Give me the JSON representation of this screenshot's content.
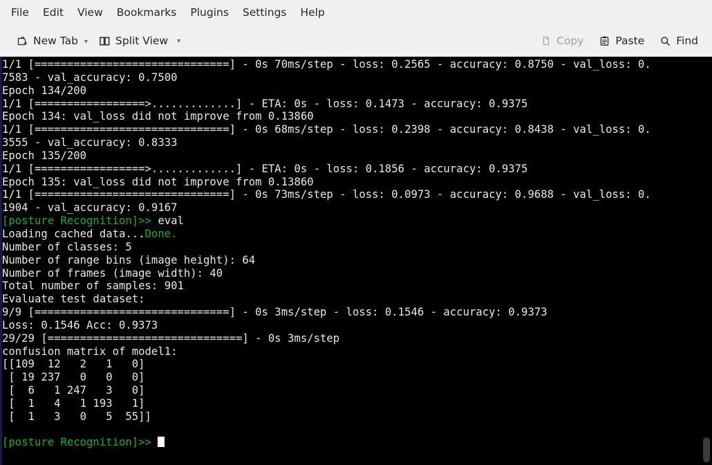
{
  "menubar": {
    "items": [
      {
        "label": "File",
        "name": "menu-file"
      },
      {
        "label": "Edit",
        "name": "menu-edit"
      },
      {
        "label": "View",
        "name": "menu-view"
      },
      {
        "label": "Bookmarks",
        "name": "menu-bookmarks"
      },
      {
        "label": "Plugins",
        "name": "menu-plugins"
      },
      {
        "label": "Settings",
        "name": "menu-settings"
      },
      {
        "label": "Help",
        "name": "menu-help"
      }
    ]
  },
  "toolbar": {
    "new_tab_label": "New Tab",
    "split_view_label": "Split View",
    "copy_label": "Copy",
    "paste_label": "Paste",
    "find_label": "Find",
    "copy_disabled": true
  },
  "terminal": {
    "prompt": "[posture Recognition]>>",
    "command": " eval",
    "lines": {
      "l01": "1/1 [==============================] - 0s 70ms/step - loss: 0.2565 - accuracy: 0.8750 - val_loss: 0.",
      "l02": "7583 - val_accuracy: 0.7500",
      "l03": "Epoch 134/200",
      "l04": "1/1 [=================>.............] - ETA: 0s - loss: 0.1473 - accuracy: 0.9375",
      "l05": "Epoch 134: val_loss did not improve from 0.13860",
      "l06": "1/1 [==============================] - 0s 68ms/step - loss: 0.2398 - accuracy: 0.8438 - val_loss: 0.",
      "l07": "3555 - val_accuracy: 0.8333",
      "l08": "Epoch 135/200",
      "l09": "1/1 [=================>.............] - ETA: 0s - loss: 0.1856 - accuracy: 0.9375",
      "l10": "Epoch 135: val_loss did not improve from 0.13860",
      "l11": "1/1 [==============================] - 0s 73ms/step - loss: 0.0973 - accuracy: 0.9688 - val_loss: 0.",
      "l12": "1904 - val_accuracy: 0.9167",
      "l13_loading": "Loading cached data...",
      "l13_done": "Done.",
      "l14": "Number of classes: 5",
      "l15": "Number of range bins (image height): 64",
      "l16": "Number of frames (image width): 40",
      "l17": "Total number of samples: 901",
      "l18": "Evaluate test dataset:",
      "l19": "9/9 [==============================] - 0s 3ms/step - loss: 0.1546 - accuracy: 0.9373",
      "l20": "Loss: 0.1546 Acc: 0.9373",
      "l21": "29/29 [==============================] - 0s 3ms/step",
      "l22": "confusion matrix of model1:",
      "matrix_rows": [
        "[[109  12   2   1   0]",
        " [ 19 237   0   0   0]",
        " [  6   1 247   3   0]",
        " [  1   4   1 193   1]",
        " [  1   3   0   5  55]]"
      ]
    },
    "colors": {
      "background": "#000000",
      "foreground": "#e8e8e8",
      "prompt_green": "#18b218",
      "marker_blue": "#141a4a"
    }
  }
}
